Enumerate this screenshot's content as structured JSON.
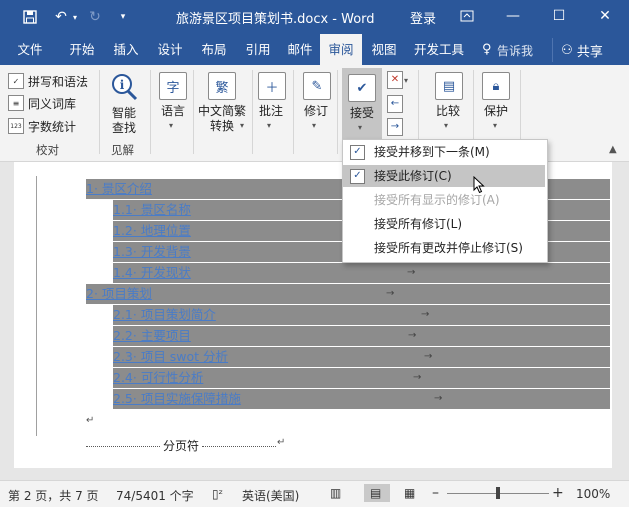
{
  "window": {
    "title": "旅游景区项目策划书.docx - Word",
    "user": "登录"
  },
  "tabs": [
    "文件",
    "开始",
    "插入",
    "设计",
    "布局",
    "引用",
    "邮件",
    "审阅",
    "视图",
    "开发工具"
  ],
  "active_tab": "审阅",
  "tell_me": "告诉我",
  "share": "共享",
  "ribbon": {
    "proofing": {
      "items": [
        "拼写和语法",
        "同义词库",
        "字数统计"
      ],
      "label": "校对"
    },
    "insights": {
      "button": [
        "智能",
        "查找"
      ],
      "label": "见解"
    },
    "language": {
      "button": "语言"
    },
    "chinese": {
      "button": [
        "中文简繁",
        "转换"
      ]
    },
    "comments": {
      "button": "批注"
    },
    "tracking": {
      "button": "修订"
    },
    "accept": {
      "button": "接受"
    },
    "compare": {
      "button": "比较"
    },
    "protect": {
      "button": "保护"
    }
  },
  "accept_menu": {
    "items": [
      {
        "label": "接受并移到下一条(M)",
        "checked": true,
        "state": "normal"
      },
      {
        "label": "接受此修订(C)",
        "checked": true,
        "state": "hover"
      },
      {
        "label": "接受所有显示的修订(A)",
        "checked": false,
        "state": "disabled"
      },
      {
        "label": "接受所有修订(L)",
        "checked": false,
        "state": "normal"
      },
      {
        "label": "接受所有更改并停止修订(S)",
        "checked": false,
        "state": "normal"
      }
    ]
  },
  "document": {
    "toc": [
      {
        "text": "1· 景区介绍",
        "level": 1
      },
      {
        "text": "1.1· 景区名称",
        "level": 2
      },
      {
        "text": "1.2· 地理位置",
        "level": 2
      },
      {
        "text": "1.3· 开发背景",
        "level": 2
      },
      {
        "text": "1.4· 开发现状",
        "level": 2
      },
      {
        "text": "2· 项目策划",
        "level": 1
      },
      {
        "text": "2.1· 项目策划简介",
        "level": 2
      },
      {
        "text": "2.2· 主要项目",
        "level": 2
      },
      {
        "text": "2.3· 项目 swot 分析",
        "level": 2
      },
      {
        "text": "2.4· 可行性分析",
        "level": 2
      },
      {
        "text": "2.5· 项目实施保障措施",
        "level": 2
      }
    ],
    "page_break": "分页符"
  },
  "status": {
    "page": "第 2 页，共 7 页",
    "words": "74/5401 个字",
    "language": "英语(美国)",
    "zoom": "100%",
    "zoom_level": 0.5
  },
  "colors": {
    "accent": "#2b579a",
    "highlight": "#8c8c8c",
    "link": "#4a7cc7"
  }
}
